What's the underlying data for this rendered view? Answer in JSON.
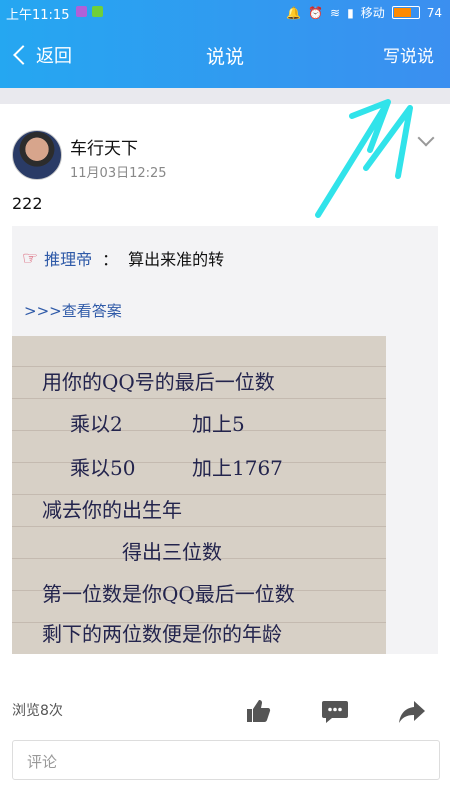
{
  "status_bar": {
    "time": "上午11:15",
    "carrier": "移动",
    "battery": "74"
  },
  "navbar": {
    "back_label": "返回",
    "title": "说说",
    "write_label": "写说说"
  },
  "post": {
    "author": "车行天下",
    "date": "11月03日12:25",
    "text": "222",
    "shared": {
      "author": "推理帝",
      "colon": "：",
      "topic": "算出来准的转",
      "link": ">>>查看答案",
      "image_lines": [
        "用你的QQ号的最后一位数",
        "乘以2",
        "加上5",
        "乘以50",
        "加上1767",
        "减去你的出生年",
        "得出三位数",
        "第一位数是你QQ最后一位数",
        "剩下的两位数便是你的年龄"
      ]
    },
    "views": "浏览8次",
    "comment_placeholder": "评论"
  },
  "colors": {
    "header_start": "#25a7f1",
    "header_end": "#3b8ff0",
    "link": "#2f5aa8",
    "hand": "#d3324d"
  },
  "icons": [
    "back-chevron-icon",
    "more-chevron-icon",
    "like-icon",
    "comment-icon",
    "share-icon"
  ]
}
